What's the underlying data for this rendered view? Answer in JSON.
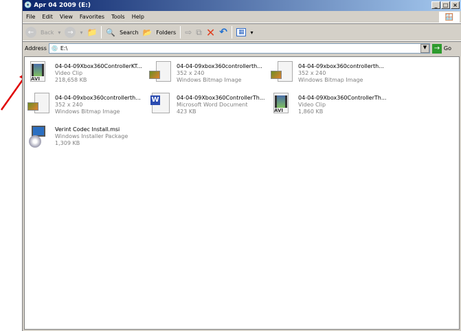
{
  "window": {
    "title": "Apr 04 2009 (E:)",
    "minimize": "_",
    "maximize": "□",
    "close": "×"
  },
  "menu": [
    "File",
    "Edit",
    "View",
    "Favorites",
    "Tools",
    "Help"
  ],
  "toolbar": {
    "back": "Back",
    "search": "Search",
    "folders": "Folders"
  },
  "address": {
    "label": "Address",
    "value": "E:\\",
    "go": "Go"
  },
  "files": [
    {
      "name": "04-04-09Xbox360ControllerKT...",
      "line2": "Video Clip",
      "line3": "218,658 KB",
      "type": "avi"
    },
    {
      "name": "04-04-09xbox360controllerth...",
      "line2": "352 x 240",
      "line3": "Windows Bitmap Image",
      "type": "bmp"
    },
    {
      "name": "04-04-09xbox360controllerth...",
      "line2": "352 x 240",
      "line3": "Windows Bitmap Image",
      "type": "bmp"
    },
    {
      "name": "04-04-09xbox360controllerth...",
      "line2": "352 x 240",
      "line3": "Windows Bitmap Image",
      "type": "bmp"
    },
    {
      "name": "04-04-09Xbox360ControllerTh...",
      "line2": "Microsoft Word Document",
      "line3": "423 KB",
      "type": "doc"
    },
    {
      "name": "04-04-09Xbox360ControllerTh...",
      "line2": "Video Clip",
      "line3": "1,860 KB",
      "type": "avi"
    },
    {
      "name": "Verint Codec Install.msi",
      "line2": "Windows Installer Package",
      "line3": "1,309 KB",
      "type": "msi"
    }
  ],
  "avi_label": "AVI",
  "annotation_color": "#e00000"
}
